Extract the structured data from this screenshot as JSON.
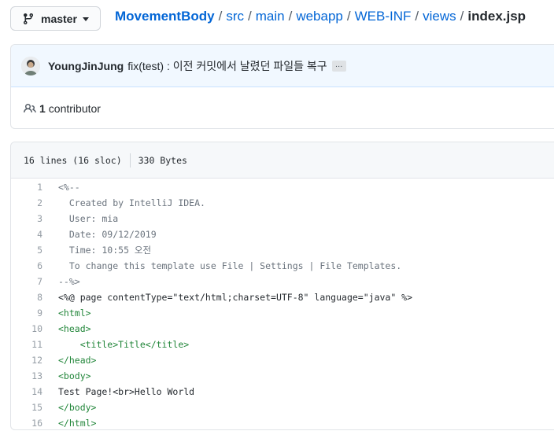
{
  "branch": {
    "label": "master",
    "icon": "git-branch-icon"
  },
  "breadcrumb": {
    "repo": "MovementBody",
    "parts": [
      "src",
      "main",
      "webapp",
      "WEB-INF",
      "views"
    ],
    "file": "index.jsp"
  },
  "commit": {
    "author": "YoungJinJung",
    "message": "fix(test) : 이전 커밋에서 날렸던 파일들 복구",
    "ellipsis": "…"
  },
  "contributors": {
    "count": "1",
    "label": "contributor"
  },
  "file_info": {
    "lines": "16 lines (16 sloc)",
    "size": "330 Bytes"
  },
  "code": {
    "line_numbers": [
      "1",
      "2",
      "3",
      "4",
      "5",
      "6",
      "7",
      "8",
      "9",
      "10",
      "11",
      "12",
      "13",
      "14",
      "15",
      "16"
    ],
    "lines": [
      "<%--",
      "  Created by IntelliJ IDEA.",
      "  User: mia",
      "  Date: 09/12/2019",
      "  Time: 10:55 오전",
      "  To change this template use File | Settings | File Templates.",
      "--%>",
      "<%@ page contentType=\"text/html;charset=UTF-8\" language=\"java\" %>",
      "<html>",
      "<head>",
      "    <title>Title</title>",
      "</head>",
      "<body>",
      "Test Page!<br>Hello World",
      "</body>",
      "</html>"
    ]
  }
}
